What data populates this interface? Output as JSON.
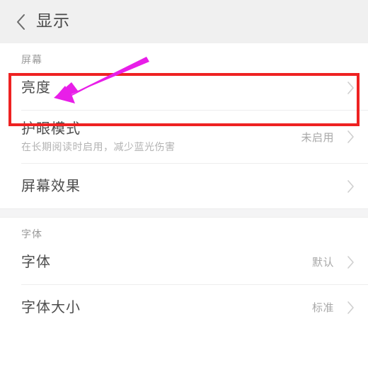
{
  "header": {
    "back_icon": "chevron-left-icon",
    "title": "显示"
  },
  "sections": [
    {
      "label": "屏幕",
      "rows": [
        {
          "title": "亮度",
          "subtitle": "",
          "value": "",
          "chevron": "chevron-right-icon",
          "highlighted": true
        },
        {
          "title": "护眼模式",
          "subtitle": "在长期阅读时启用，减少蓝光伤害",
          "value": "未启用",
          "chevron": "chevron-right-icon",
          "highlighted": false
        },
        {
          "title": "屏幕效果",
          "subtitle": "",
          "value": "",
          "chevron": "chevron-right-icon",
          "highlighted": false
        }
      ]
    },
    {
      "label": "字体",
      "rows": [
        {
          "title": "字体",
          "subtitle": "",
          "value": "默认",
          "chevron": "chevron-right-icon",
          "highlighted": false
        },
        {
          "title": "字体大小",
          "subtitle": "",
          "value": "标准",
          "chevron": "chevron-right-icon",
          "highlighted": false
        }
      ]
    }
  ],
  "annotations": {
    "highlight_color": "#ee2222",
    "arrow_color": "#e81ee8",
    "arrow_target": "亮度",
    "highlight_target": "亮度"
  }
}
